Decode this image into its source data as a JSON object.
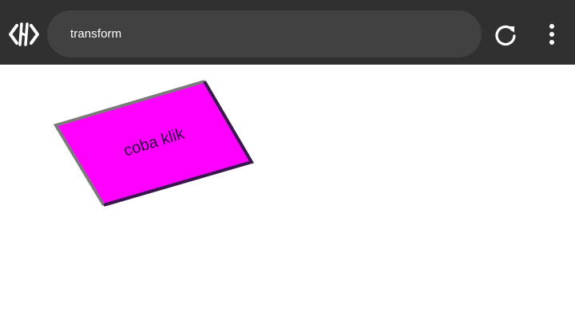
{
  "browser": {
    "address_text": "transform",
    "icons": {
      "logo": "code-brackets-logo-icon",
      "reload": "reload-icon",
      "menu": "vertical-dots-menu-icon"
    },
    "colors": {
      "toolbar_bg": "#303030",
      "address_bg": "#414141",
      "icon": "#ffffff"
    }
  },
  "page": {
    "button_label": "coba klik",
    "colors": {
      "button_fill": "#ff00ff",
      "button_border_dark": "#3b1450",
      "button_border_light": "#7a7a7a",
      "text": "#2a0a40"
    }
  }
}
